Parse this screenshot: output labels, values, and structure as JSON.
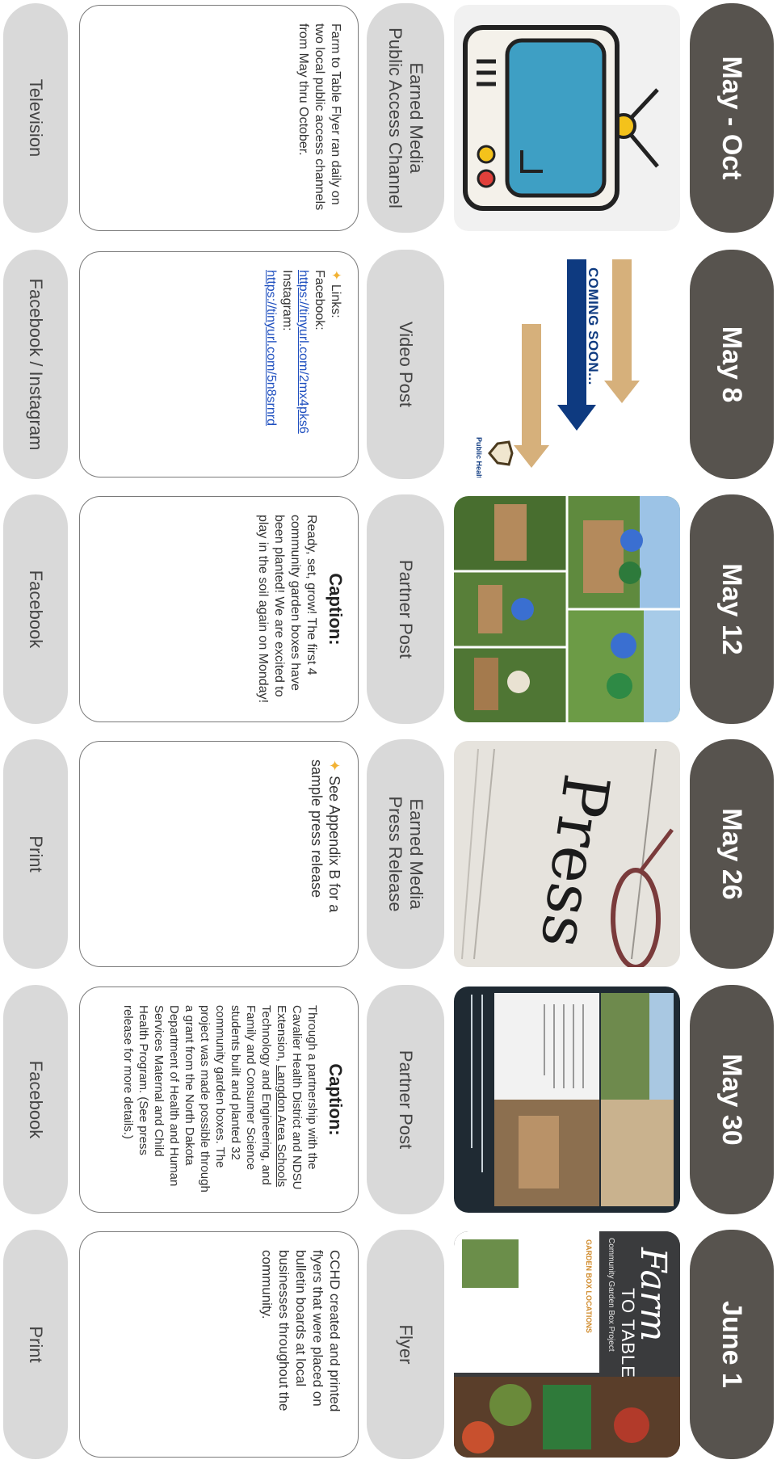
{
  "timeline": [
    {
      "date": "May - Oct",
      "type_lines": [
        "Earned Media",
        "Public Access Channel"
      ],
      "channel": "Television",
      "image_icon": "television-icon",
      "description": "Farm to Table Flyer ran daily on two local public access channels from May thru October."
    },
    {
      "date": "May 8",
      "type_lines": [
        "Video Post"
      ],
      "channel": "Facebook / Instagram",
      "image_icon": "coming-soon-graphic",
      "image_text": "COMING SOON...",
      "image_logo_text": "Public Health",
      "links_label": "Links:",
      "facebook_label": "Facebook:",
      "facebook_url": "https://tinyurl.com/2mx4pks6",
      "instagram_label": "Instagram:",
      "instagram_url": "https://tinyurl.com/5n8srnrd"
    },
    {
      "date": "May 12",
      "type_lines": [
        "Partner Post"
      ],
      "channel": "Facebook",
      "image_icon": "garden-photo-collage",
      "caption_title": "Caption:",
      "description": "Ready, set, grow! The first 4 community garden boxes have been planted! We are excited to play in the soil again on Monday!"
    },
    {
      "date": "May 26",
      "type_lines": [
        "Earned Media",
        "Press Release"
      ],
      "channel": "Print",
      "image_icon": "press-release-photo",
      "image_text": "Press Re",
      "description": "See Appendix B for a sample press release"
    },
    {
      "date": "May 30",
      "type_lines": [
        "Partner Post"
      ],
      "channel": "Facebook",
      "image_icon": "partner-post-collage",
      "caption_title": "Caption:",
      "description_parts": [
        "Through a partnership with the Cavalier Health District and NDSU Extension, ",
        "Langdon Area Schools",
        " Technology and Engineering, and Family and Consumer Science students built and planted 32 community garden boxes. The project was made possible through a grant from the North Dakota Department of Health and Human Services Maternal and Child Health Program. (See press release for more details.)"
      ]
    },
    {
      "date": "June 1",
      "type_lines": [
        "Flyer"
      ],
      "channel": "Print",
      "image_icon": "farm-to-table-flyer",
      "flyer_title_script": "Farm",
      "flyer_title": "TO TABLE",
      "flyer_subtitle": "Community Garden Box Project",
      "flyer_locations_label": "GARDEN BOX LOCATIONS",
      "description": "CCHD created and printed flyers that were placed on bulletin boards at local businesses throughout the community."
    }
  ],
  "colors": {
    "date_pill": "#57534e",
    "type_pill": "#d9d9d9",
    "link": "#1f4fbf",
    "star": "#f2b233"
  }
}
